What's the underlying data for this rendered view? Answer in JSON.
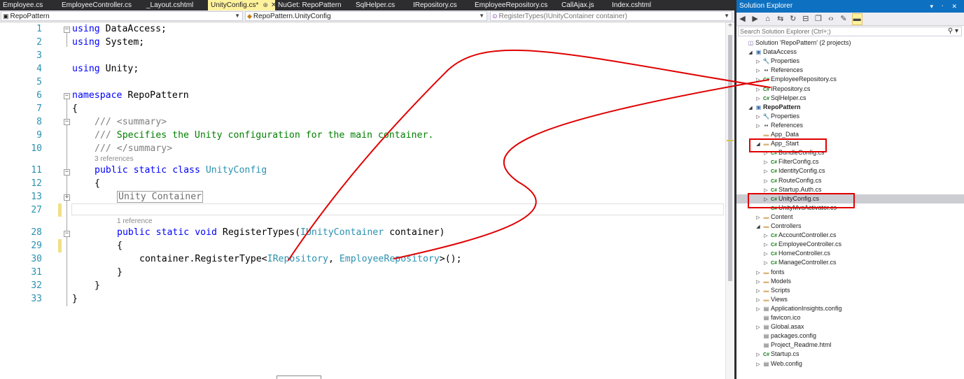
{
  "tabs": [
    {
      "label": "Employee.cs",
      "active": false
    },
    {
      "label": "EmployeeController.cs",
      "active": false
    },
    {
      "label": "_Layout.cshtml",
      "active": false
    },
    {
      "label": "UnityConfig.cs*",
      "active": true,
      "pin": "⊕",
      "close": "✕"
    },
    {
      "label": "NuGet: RepoPattern",
      "active": false
    },
    {
      "label": "SqlHelper.cs",
      "active": false
    },
    {
      "label": "IRepository.cs",
      "active": false
    },
    {
      "label": "EmployeeRepository.cs",
      "active": false
    },
    {
      "label": "CallAjax.js",
      "active": false
    },
    {
      "label": "Index.cshtml",
      "active": false
    }
  ],
  "navbar": {
    "project": "RepoPattern",
    "class": "RepoPattern.UnityConfig",
    "member": "RegisterTypes(IUnityContainer container)"
  },
  "editor": {
    "code_lens_1": "3 references",
    "code_lens_2": "1 reference",
    "lines": [
      {
        "num": "1",
        "text": "using DataAccess;"
      },
      {
        "num": "2",
        "text": "using System;"
      },
      {
        "num": "3",
        "text": ""
      },
      {
        "num": "4",
        "text": "using Unity;"
      },
      {
        "num": "5",
        "text": ""
      },
      {
        "num": "6",
        "text": "namespace RepoPattern"
      },
      {
        "num": "7",
        "text": "{"
      },
      {
        "num": "8",
        "text": "    /// <summary>"
      },
      {
        "num": "9",
        "text": "    /// Specifies the Unity configuration for the main container."
      },
      {
        "num": "10",
        "text": "    /// </summary>"
      },
      {
        "num": "11",
        "text": "    public static class UnityConfig"
      },
      {
        "num": "12",
        "text": "    {"
      },
      {
        "num": "13",
        "text": "        Unity Container"
      },
      {
        "num": "27",
        "text": ""
      },
      {
        "num": "28",
        "text": "        public static void RegisterTypes(IUnityContainer container)"
      },
      {
        "num": "29",
        "text": "        {"
      },
      {
        "num": "30",
        "text": "            container.RegisterType<IRepository, EmployeeRepository>();"
      },
      {
        "num": "31",
        "text": "        }"
      },
      {
        "num": "32",
        "text": "    }"
      },
      {
        "num": "33",
        "text": "}"
      }
    ],
    "tokens": {
      "using": "using",
      "namespace": "namespace",
      "public": "public",
      "static": "static",
      "class": "class",
      "void": "void",
      "ns_dataaccess": " DataAccess;",
      "ns_system": " System;",
      "ns_unity": " Unity;",
      "ns_repopattern": " RepoPattern",
      "brace_open": "{",
      "brace_close": "}",
      "doc_prefix": "/// ",
      "summary_open": "<summary>",
      "summary_close": "</summary>",
      "doc_text": "Specifies the Unity configuration for the main container.",
      "class_name": "UnityConfig",
      "collapsed_region": "Unity Container",
      "method_name": " RegisterTypes(",
      "param_type": "IUnityContainer",
      "param_name": " container)",
      "call_prefix": "container.RegisterType<",
      "iface": "IRepository",
      "comma": ", ",
      "impl": "EmployeeRepository",
      "call_suffix": ">();"
    }
  },
  "solution_explorer": {
    "title": "Solution Explorer",
    "title_buttons": "▾ ᛫ ✕",
    "search_placeholder": "Search Solution Explorer (Ctrl+;)",
    "tree": [
      {
        "label": "Solution 'RepoPattern' (2 projects)",
        "depth": 0,
        "expander": "",
        "icon": "sln",
        "bold": false
      },
      {
        "label": "DataAccess",
        "depth": 1,
        "expander": "◢",
        "icon": "proj",
        "bold": false
      },
      {
        "label": "Properties",
        "depth": 2,
        "expander": "▷",
        "icon": "wrench",
        "bold": false
      },
      {
        "label": "References",
        "depth": 2,
        "expander": "▷",
        "icon": "refs",
        "bold": false
      },
      {
        "label": "EmployeeRepository.cs",
        "depth": 2,
        "expander": "▷",
        "icon": "cs",
        "bold": false
      },
      {
        "label": "IRepository.cs",
        "depth": 2,
        "expander": "▷",
        "icon": "cs",
        "bold": false
      },
      {
        "label": "SqlHelper.cs",
        "depth": 2,
        "expander": "▷",
        "icon": "cs",
        "bold": false
      },
      {
        "label": "RepoPattern",
        "depth": 1,
        "expander": "◢",
        "icon": "proj",
        "bold": true
      },
      {
        "label": "Properties",
        "depth": 2,
        "expander": "▷",
        "icon": "wrench",
        "bold": false
      },
      {
        "label": "References",
        "depth": 2,
        "expander": "▷",
        "icon": "refs",
        "bold": false
      },
      {
        "label": "App_Data",
        "depth": 2,
        "expander": "",
        "icon": "folder",
        "bold": false
      },
      {
        "label": "App_Start",
        "depth": 2,
        "expander": "◢",
        "icon": "folder",
        "bold": false
      },
      {
        "label": "BundleConfig.cs",
        "depth": 3,
        "expander": "▷",
        "icon": "cs",
        "bold": false
      },
      {
        "label": "FilterConfig.cs",
        "depth": 3,
        "expander": "▷",
        "icon": "cs",
        "bold": false
      },
      {
        "label": "IdentityConfig.cs",
        "depth": 3,
        "expander": "▷",
        "icon": "cs",
        "bold": false
      },
      {
        "label": "RouteConfig.cs",
        "depth": 3,
        "expander": "▷",
        "icon": "cs",
        "bold": false
      },
      {
        "label": "Startup.Auth.cs",
        "depth": 3,
        "expander": "▷",
        "icon": "cs",
        "bold": false
      },
      {
        "label": "UnityConfig.cs",
        "depth": 3,
        "expander": "▷",
        "icon": "cs",
        "bold": false,
        "selected": true
      },
      {
        "label": "UnityMvcActivator.cs",
        "depth": 3,
        "expander": "",
        "icon": "cs",
        "bold": false
      },
      {
        "label": "Content",
        "depth": 2,
        "expander": "▷",
        "icon": "folder",
        "bold": false
      },
      {
        "label": "Controllers",
        "depth": 2,
        "expander": "◢",
        "icon": "folder",
        "bold": false
      },
      {
        "label": "AccountController.cs",
        "depth": 3,
        "expander": "▷",
        "icon": "cs",
        "bold": false
      },
      {
        "label": "EmployeeController.cs",
        "depth": 3,
        "expander": "▷",
        "icon": "cs",
        "bold": false
      },
      {
        "label": "HomeController.cs",
        "depth": 3,
        "expander": "▷",
        "icon": "cs",
        "bold": false
      },
      {
        "label": "ManageController.cs",
        "depth": 3,
        "expander": "▷",
        "icon": "cs",
        "bold": false
      },
      {
        "label": "fonts",
        "depth": 2,
        "expander": "▷",
        "icon": "folder",
        "bold": false
      },
      {
        "label": "Models",
        "depth": 2,
        "expander": "▷",
        "icon": "folder",
        "bold": false
      },
      {
        "label": "Scripts",
        "depth": 2,
        "expander": "▷",
        "icon": "folder",
        "bold": false
      },
      {
        "label": "Views",
        "depth": 2,
        "expander": "▷",
        "icon": "folder",
        "bold": false
      },
      {
        "label": "ApplicationInsights.config",
        "depth": 2,
        "expander": "▷",
        "icon": "file",
        "bold": false
      },
      {
        "label": "favicon.ico",
        "depth": 2,
        "expander": "",
        "icon": "file",
        "bold": false
      },
      {
        "label": "Global.asax",
        "depth": 2,
        "expander": "▷",
        "icon": "file",
        "bold": false
      },
      {
        "label": "packages.config",
        "depth": 2,
        "expander": "",
        "icon": "file",
        "bold": false
      },
      {
        "label": "Project_Readme.html",
        "depth": 2,
        "expander": "",
        "icon": "file",
        "bold": false
      },
      {
        "label": "Startup.cs",
        "depth": 2,
        "expander": "▷",
        "icon": "cs",
        "bold": false
      },
      {
        "label": "Web.config",
        "depth": 2,
        "expander": "▷",
        "icon": "file",
        "bold": false
      }
    ],
    "toolbar_icons": [
      "back-icon",
      "forward-icon",
      "home-icon",
      "sync-icon",
      "refresh-icon",
      "collapse-all-icon",
      "show-all-files-icon",
      "view-code-icon",
      "properties-icon",
      "pin-icon"
    ]
  },
  "colors": {
    "annotation": "#e00000",
    "keyword": "#0000ff",
    "type": "#2b91af",
    "comment": "#008000",
    "active_tab": "#fff29d",
    "title_bar": "#0e70c0"
  }
}
